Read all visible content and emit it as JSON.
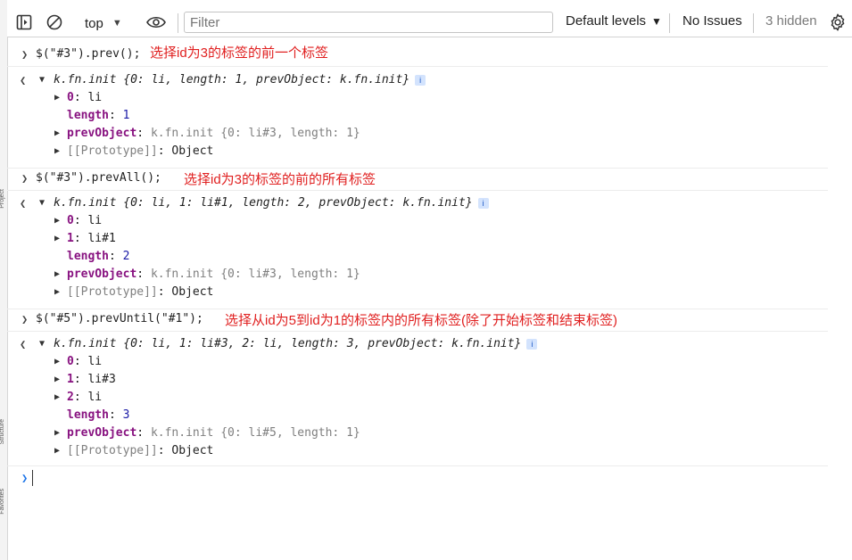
{
  "toolbar": {
    "context": "top",
    "filter_placeholder": "Filter",
    "levels": "Default levels",
    "issues": "No Issues",
    "hidden": "3 hidden"
  },
  "sidebar_labels": [
    "Project",
    "Structure",
    "Favorites"
  ],
  "entries": [
    {
      "command": "$(\"#3\").prev();",
      "annotation": "选择id为3的标签的前一个标签",
      "summary": "k.fn.init {0: li, length: 1, prevObject: k.fn.init}",
      "props": [
        {
          "key": "0",
          "value": "li"
        },
        {
          "key": "length",
          "value": "1"
        },
        {
          "key": "prevObject",
          "value": "k.fn.init {0: li#3, length: 1}"
        },
        {
          "key": "[[Prototype]]",
          "value": "Object"
        }
      ]
    },
    {
      "command": "$(\"#3\").prevAll();",
      "annotation": "选择id为3的标签的前的所有标签",
      "summary": "k.fn.init {0: li, 1: li#1, length: 2, prevObject: k.fn.init}",
      "props": [
        {
          "key": "0",
          "value": "li"
        },
        {
          "key": "1",
          "value": "li#1"
        },
        {
          "key": "length",
          "value": "2"
        },
        {
          "key": "prevObject",
          "value": "k.fn.init {0: li#3, length: 1}"
        },
        {
          "key": "[[Prototype]]",
          "value": "Object"
        }
      ]
    },
    {
      "command": "$(\"#5\").prevUntil(\"#1\");",
      "annotation": "选择从id为5到id为1的标签内的所有标签(除了开始标签和结束标签)",
      "summary": "k.fn.init {0: li, 1: li#3, 2: li, length: 3, prevObject: k.fn.init}",
      "props": [
        {
          "key": "0",
          "value": "li"
        },
        {
          "key": "1",
          "value": "li#3"
        },
        {
          "key": "2",
          "value": "li"
        },
        {
          "key": "length",
          "value": "3"
        },
        {
          "key": "prevObject",
          "value": "k.fn.init {0: li#5, length: 1}"
        },
        {
          "key": "[[Prototype]]",
          "value": "Object"
        }
      ]
    }
  ]
}
